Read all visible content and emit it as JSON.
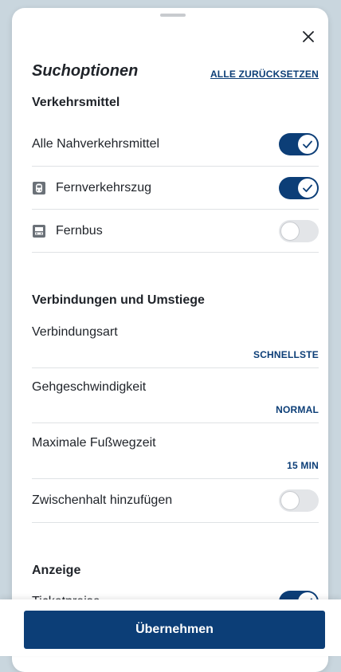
{
  "header": {
    "title": "Suchoptionen",
    "reset_label": "ALLE ZURÜCKSETZEN"
  },
  "transport": {
    "heading": "Verkehrsmittel",
    "all_local": {
      "label": "Alle Nahverkehrsmittel",
      "enabled": true
    },
    "long_distance_train": {
      "label": "Fernverkehrszug",
      "icon": "train-icon",
      "enabled": true
    },
    "long_distance_bus": {
      "label": "Fernbus",
      "icon": "bus-icon",
      "enabled": false
    }
  },
  "connections": {
    "heading": "Verbindungen und Umstiege",
    "connection_type": {
      "label": "Verbindungsart",
      "value": "SCHNELLSTE"
    },
    "walking_speed": {
      "label": "Gehgeschwindigkeit",
      "value": "NORMAL"
    },
    "max_walk_time": {
      "label": "Maximale Fußwegzeit",
      "value": "15 MIN"
    },
    "add_stopover": {
      "label": "Zwischenhalt hinzufügen",
      "enabled": false
    }
  },
  "display": {
    "heading": "Anzeige",
    "ticket_prices": {
      "label": "Ticketpreise",
      "enabled": true
    }
  },
  "footer": {
    "apply_label": "Übernehmen"
  },
  "colors": {
    "accent": "#0c3e77",
    "toggle_off": "#e3e5e8",
    "background": "#c9d6de"
  }
}
